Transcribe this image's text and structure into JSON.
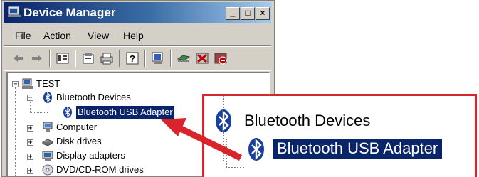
{
  "window": {
    "title": "Device Manager",
    "controls": {
      "minimize": "_",
      "maximize": "□",
      "close": "×"
    }
  },
  "menu": {
    "items": [
      {
        "label": "File"
      },
      {
        "label": "Action"
      },
      {
        "label": "View"
      },
      {
        "label": "Help"
      }
    ]
  },
  "toolbar": {
    "icons": [
      "back-arrow-icon",
      "forward-arrow-icon",
      "properties-panel-icon",
      "properties-icon",
      "print-icon",
      "help-icon",
      "scan-hardware-icon",
      "update-driver-icon",
      "uninstall-icon",
      "disable-device-icon"
    ]
  },
  "tree": {
    "root": "TEST",
    "nodes": [
      {
        "label": "Bluetooth Devices",
        "expanded": true
      },
      {
        "label": "Bluetooth USB Adapter",
        "selected": true
      },
      {
        "label": "Computer",
        "expanded": false
      },
      {
        "label": "Disk drives",
        "expanded": false
      },
      {
        "label": "Display adapters",
        "expanded": false
      },
      {
        "label": "DVD/CD-ROM drives",
        "expanded": false
      }
    ]
  },
  "callout": {
    "category": "Bluetooth Devices",
    "device": "Bluetooth USB Adapter"
  },
  "colors": {
    "titlebar_start": "#0a246a",
    "titlebar_end": "#a6caf0",
    "selection": "#0a246a",
    "callout_border": "#d8242a",
    "window_face": "#d4d0c8"
  }
}
